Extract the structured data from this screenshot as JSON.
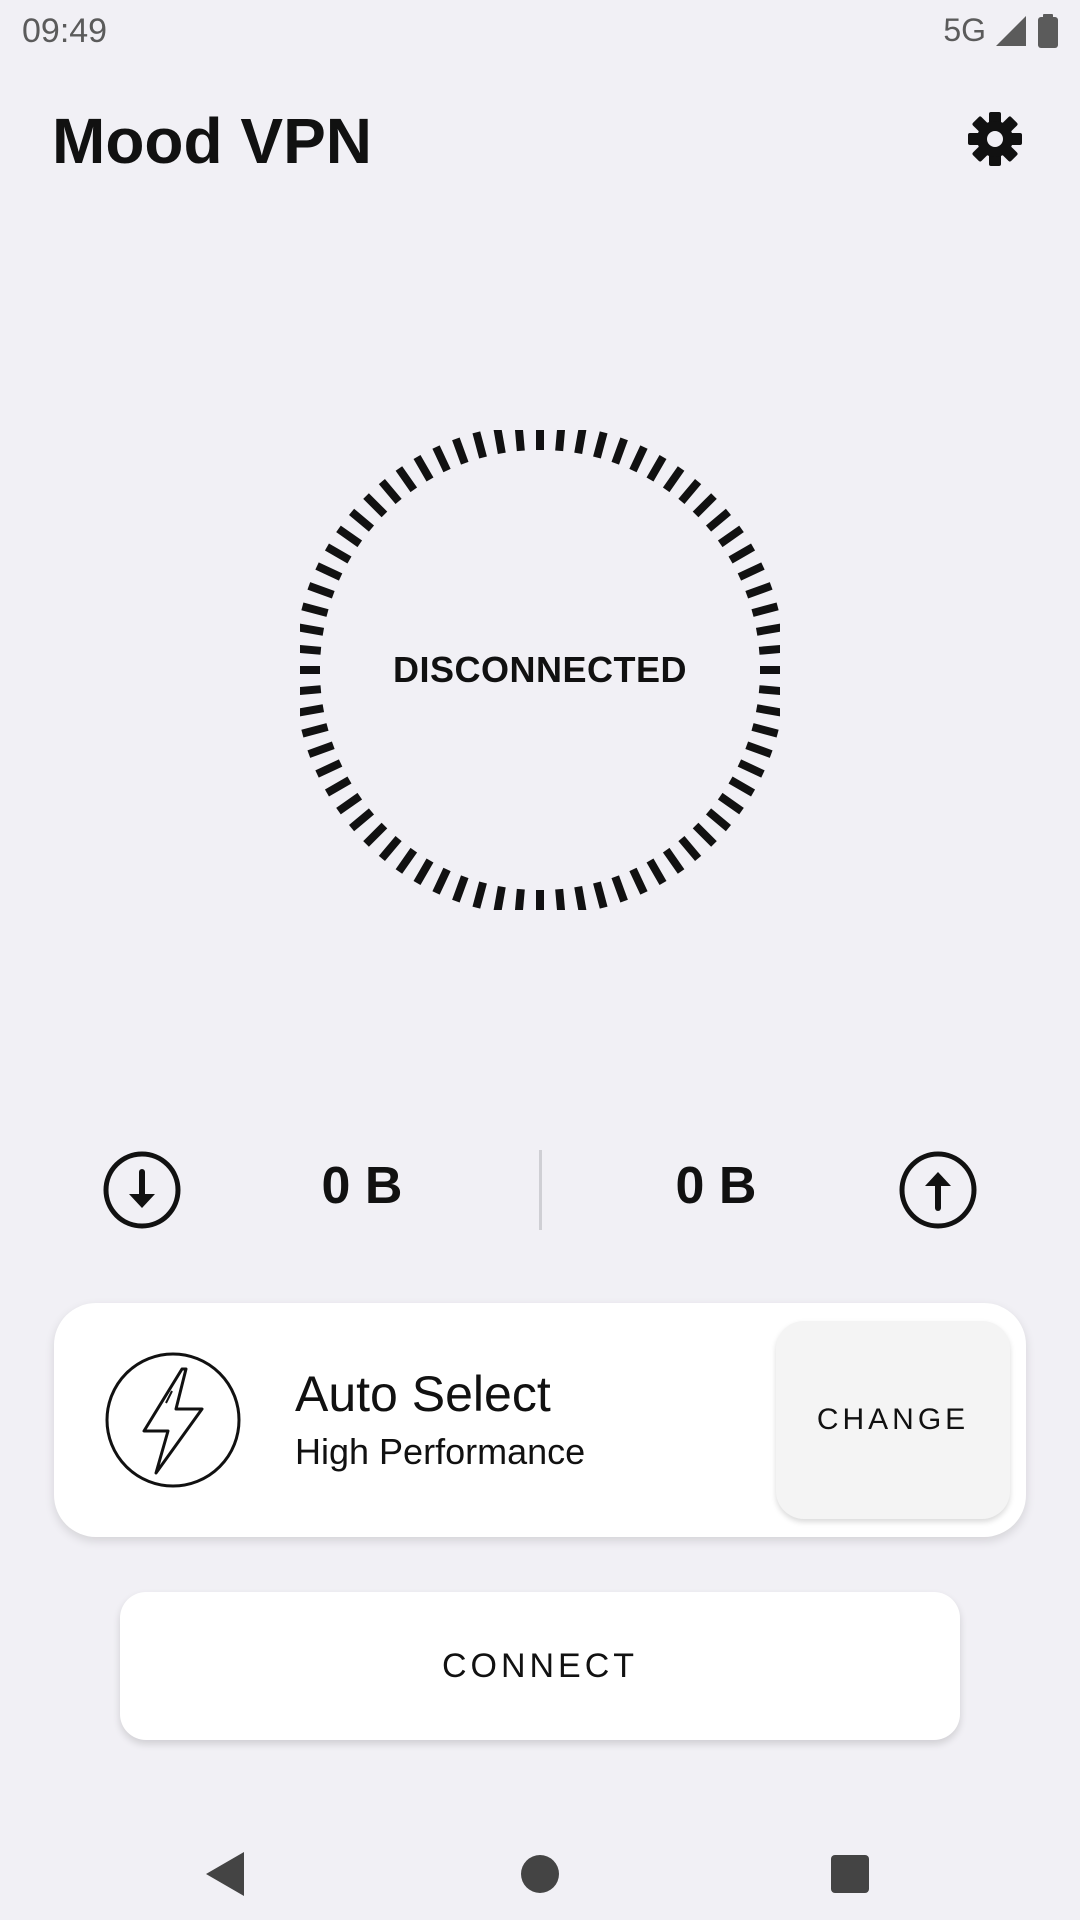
{
  "status_bar": {
    "time": "09:49",
    "network": "5G"
  },
  "header": {
    "title": "Mood VPN"
  },
  "connection": {
    "status": "DISCONNECTED"
  },
  "traffic": {
    "download": "0 B",
    "upload": "0 B"
  },
  "server": {
    "name": "Auto Select",
    "subtitle": "High Performance",
    "change_label": "CHANGE"
  },
  "actions": {
    "connect_label": "CONNECT"
  },
  "icons": {
    "signal": "signal-icon",
    "battery": "battery-icon",
    "settings": "gear-icon",
    "download": "download-arrow-icon",
    "upload": "upload-arrow-icon",
    "server": "lightning-bolt-icon",
    "back": "back-triangle-icon",
    "home": "home-circle-icon",
    "recents": "recents-square-icon"
  },
  "colors": {
    "background": "#f1f0f5",
    "card": "#ffffff",
    "text": "#111111",
    "status_text": "#5b5b5b"
  }
}
